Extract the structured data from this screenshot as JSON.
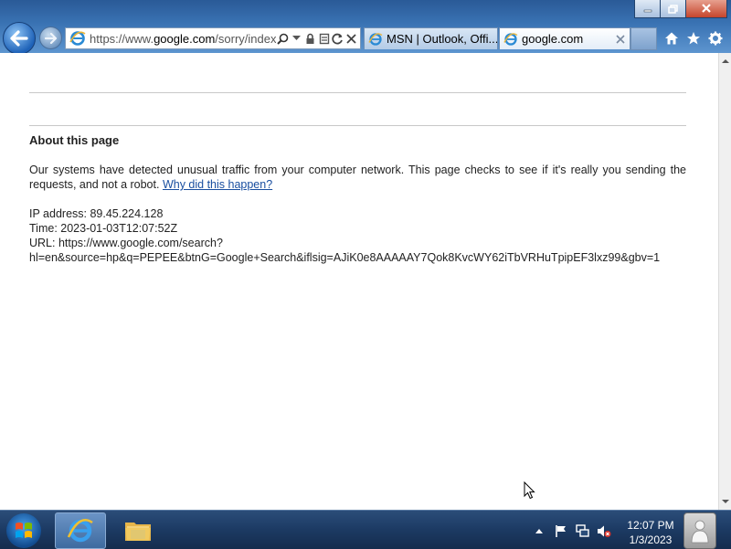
{
  "browser": {
    "address_bar": {
      "url_prefix": "https://www.",
      "url_domain": "google.com",
      "url_suffix": "/sorry/index"
    },
    "tabs": [
      {
        "label": "MSN | Outlook, Offi...",
        "active": false
      },
      {
        "label": "google.com",
        "active": true
      }
    ],
    "icons": [
      "back-icon",
      "forward-icon",
      "ie-icon",
      "search-icon",
      "dropdown-icon",
      "lock-icon",
      "compat-icon",
      "refresh-icon",
      "stop-icon",
      "home-icon",
      "favorites-icon",
      "tools-icon",
      "minimize-icon",
      "maximize-icon",
      "close-icon"
    ]
  },
  "page": {
    "heading": "About this page",
    "paragraph": "Our systems have detected unusual traffic from your computer network. This page checks to see if it's really you sending the requests, and not a robot.",
    "link": "Why did this happen?",
    "ip_line": "IP address: 89.45.224.128",
    "time_line": "Time: 2023-01-03T12:07:52Z",
    "url_line1": "URL: https://www.google.com/search?",
    "url_line2": "hl=en&source=hp&q=PEPEE&btnG=Google+Search&iflsig=AJiK0e8AAAAAY7Qok8KvcWY62iTbVRHuTpipEF3lxz99&gbv=1"
  },
  "taskbar": {
    "time": "12:07 PM",
    "date": "1/3/2023",
    "items": [
      "start-orb",
      "internet-explorer",
      "windows-explorer"
    ]
  },
  "colors": {
    "link": "#1a4fa0",
    "taskbar": "#1c3a63",
    "chrome": "#3a73b4"
  }
}
